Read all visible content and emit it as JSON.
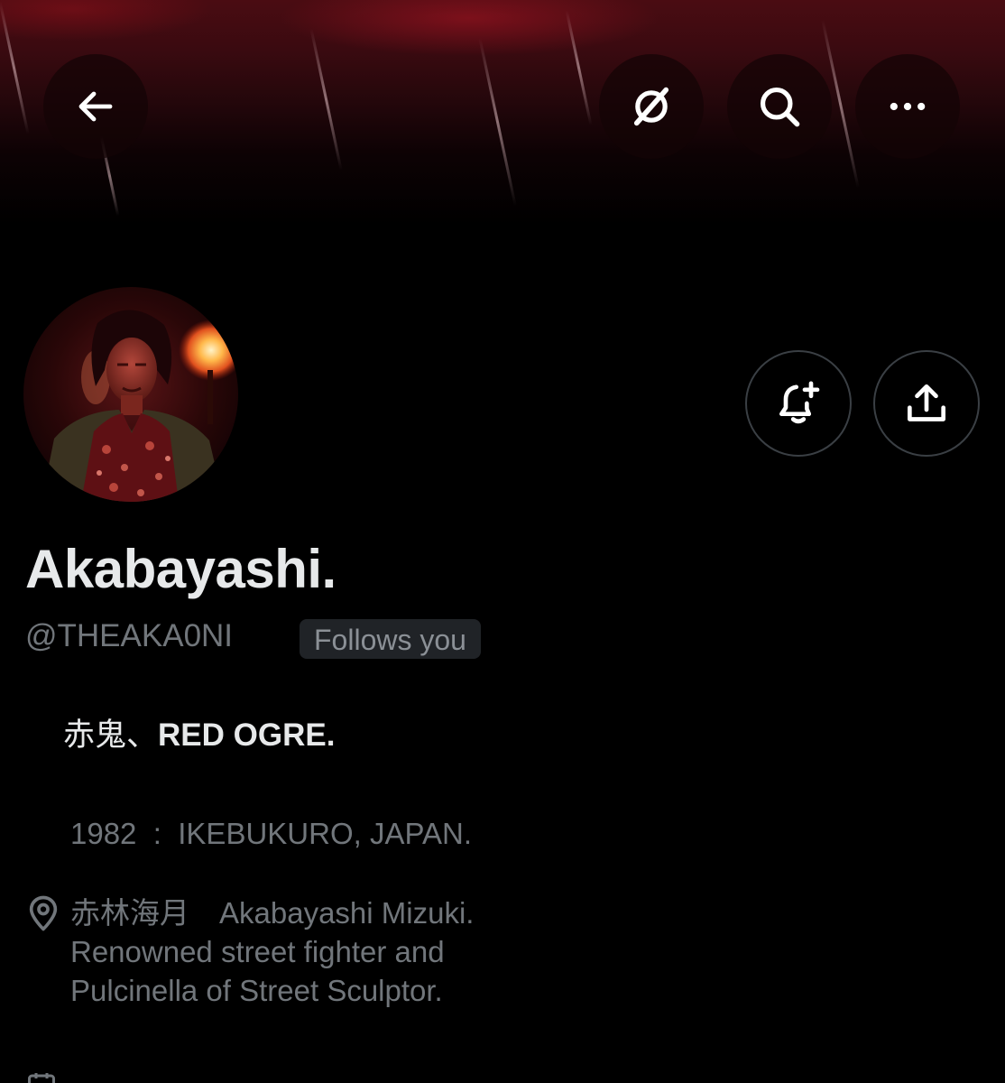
{
  "header": {
    "back_icon": "arrow-left-icon",
    "grok_icon": "grok-icon",
    "search_icon": "search-icon",
    "more_icon": "more-horizontal-icon"
  },
  "profile": {
    "display_name": "Akabayashi.",
    "handle": "@THEAKA0NI",
    "follows_you_badge": "Follows you",
    "bio": {
      "line1_prefix": "赤鬼、",
      "line1_bold": "RED OGRE."
    },
    "info_line": "1982  :  IKEBUKURO, JAPAN.",
    "location": {
      "icon": "location-pin-icon",
      "lines": [
        "赤林海月　Akabayashi Mizuki.",
        "Renowned street fighter and",
        "Pulcinella of Street Sculptor."
      ]
    }
  },
  "actions": {
    "notify_icon": "bell-plus-icon",
    "share_icon": "share-icon"
  },
  "colors": {
    "background": "#000000",
    "primary_text": "#e7e9ea",
    "secondary_text": "#71767b",
    "badge_bg": "#202327",
    "banner_red": "#4a0c12"
  }
}
